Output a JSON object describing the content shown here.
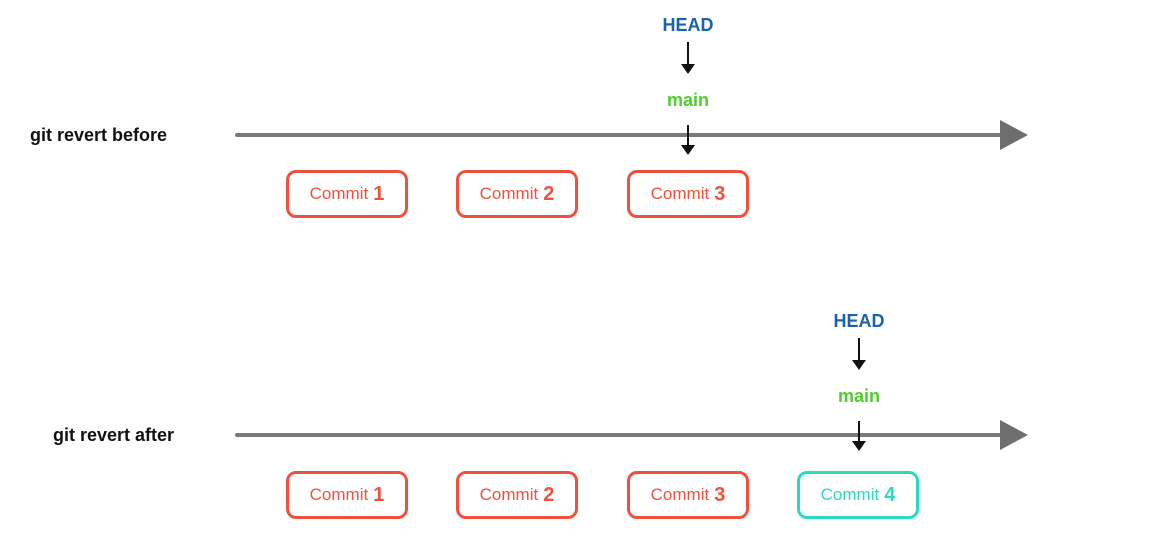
{
  "colors": {
    "head": "#1a63a8",
    "branch": "#4fcf2b",
    "commit_existing": "#f0513f",
    "commit_new": "#2bd9c0",
    "timeline": "#7a7a7a"
  },
  "before": {
    "label": "git revert before",
    "head_label": "HEAD",
    "branch_label": "main",
    "commits": [
      {
        "text": "Commit",
        "num": "1"
      },
      {
        "text": "Commit",
        "num": "2"
      },
      {
        "text": "Commit",
        "num": "3"
      }
    ]
  },
  "after": {
    "label": "git revert after",
    "head_label": "HEAD",
    "branch_label": "main",
    "commits": [
      {
        "text": "Commit",
        "num": "1"
      },
      {
        "text": "Commit",
        "num": "2"
      },
      {
        "text": "Commit",
        "num": "3"
      },
      {
        "text": "Commit",
        "num": "4"
      }
    ]
  }
}
